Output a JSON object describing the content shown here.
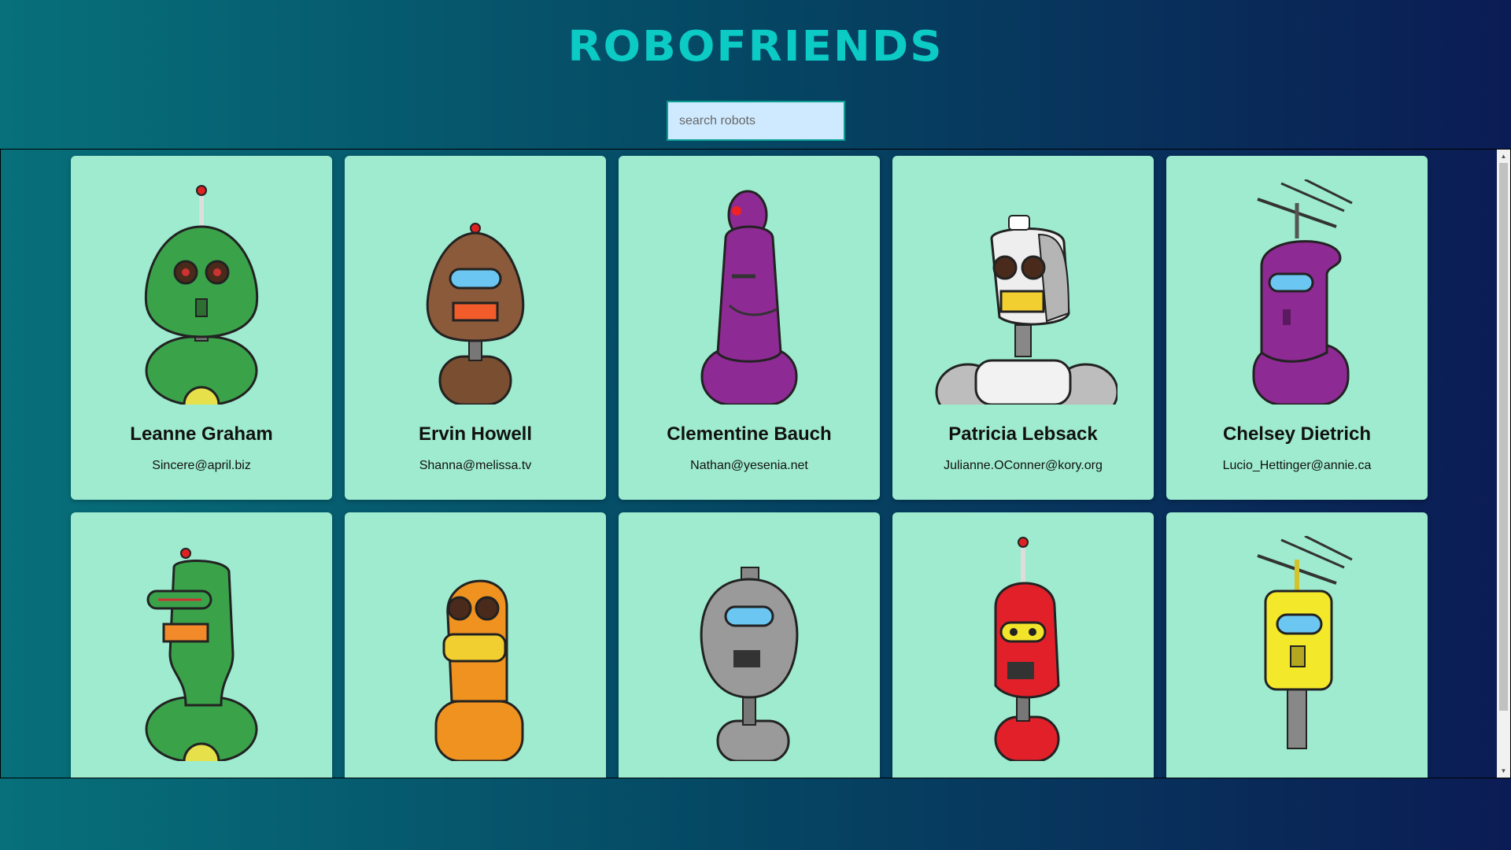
{
  "app": {
    "title": "ROBOFRIENDS"
  },
  "search": {
    "placeholder": "search robots",
    "value": ""
  },
  "robots": [
    {
      "name": "Leanne Graham",
      "email": "Sincere@april.biz",
      "color": "#3aa34a",
      "visible_info": true
    },
    {
      "name": "Ervin Howell",
      "email": "Shanna@melissa.tv",
      "color": "#8a5a3a",
      "visible_info": true
    },
    {
      "name": "Clementine Bauch",
      "email": "Nathan@yesenia.net",
      "color": "#8e2a94",
      "visible_info": true
    },
    {
      "name": "Patricia Lebsack",
      "email": "Julianne.OConner@kory.org",
      "color": "#eeeeee",
      "visible_info": true
    },
    {
      "name": "Chelsey Dietrich",
      "email": "Lucio_Hettinger@annie.ca",
      "color": "#8e2a94",
      "visible_info": true
    },
    {
      "name": "",
      "email": "",
      "color": "#3aa34a",
      "visible_info": false
    },
    {
      "name": "",
      "email": "",
      "color": "#f0921f",
      "visible_info": false
    },
    {
      "name": "",
      "email": "",
      "color": "#9a9a9a",
      "visible_info": false
    },
    {
      "name": "",
      "email": "",
      "color": "#e2202a",
      "visible_info": false
    },
    {
      "name": "",
      "email": "",
      "color": "#f3e92a",
      "visible_info": false
    }
  ]
}
